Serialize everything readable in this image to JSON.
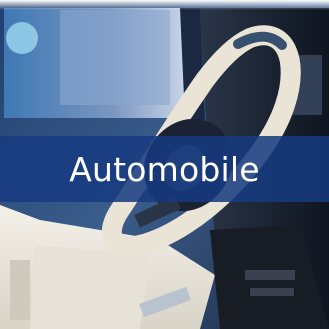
{
  "tile": {
    "label": "Automobile",
    "banner_color": "#163a80"
  },
  "image": {
    "subject": "car-interior-steering-wheel"
  }
}
